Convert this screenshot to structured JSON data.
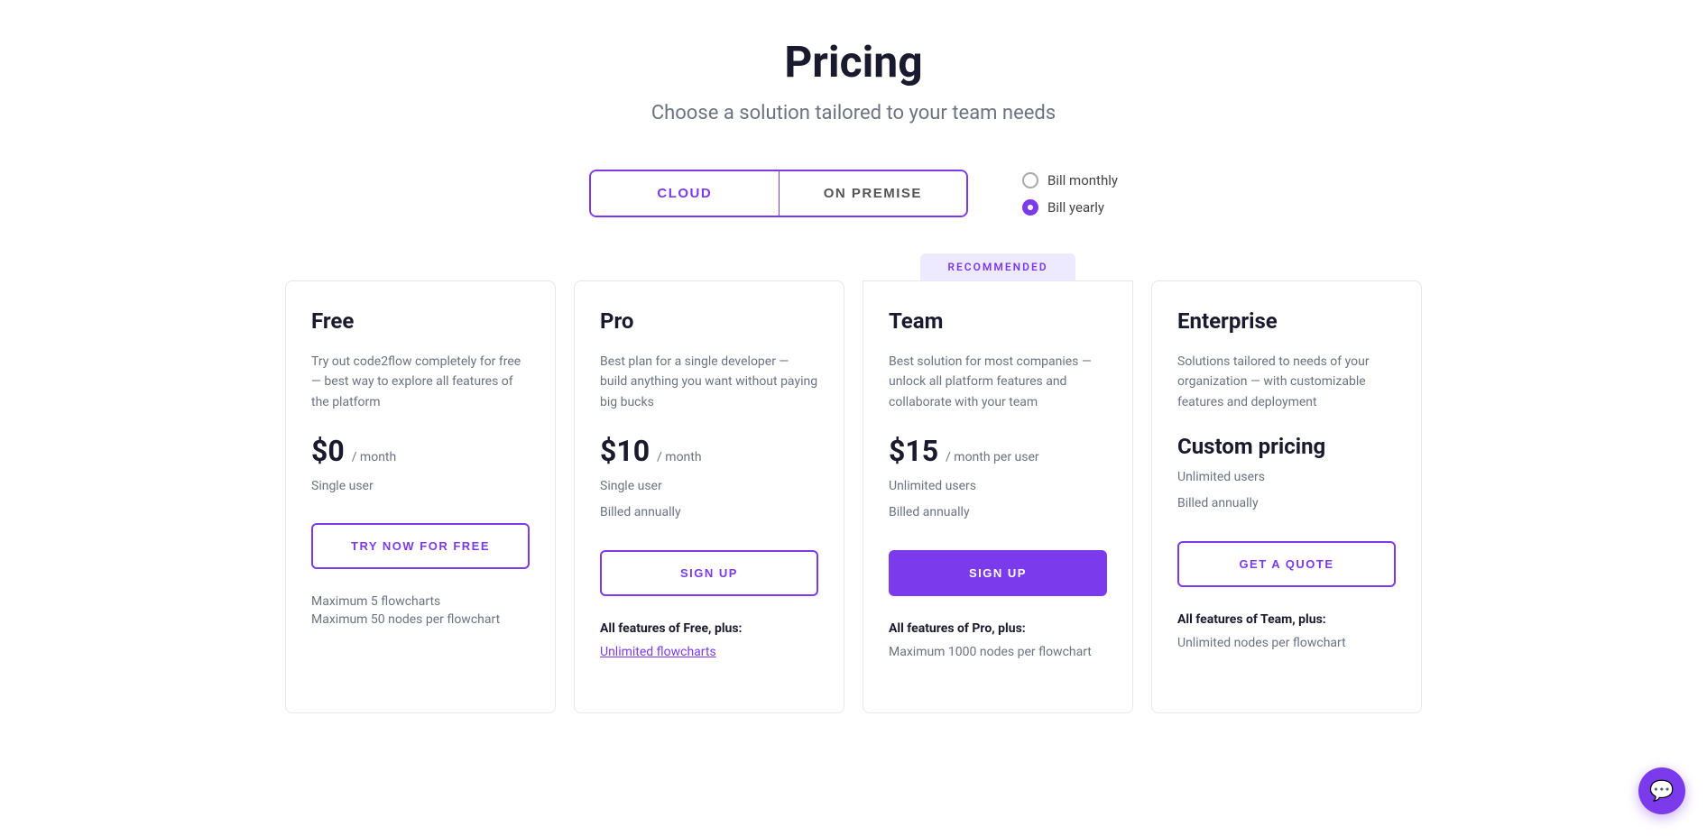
{
  "header": {
    "title": "Pricing",
    "subtitle": "Choose a solution tailored to your team needs"
  },
  "toggle": {
    "cloud_label": "CLOUD",
    "on_premise_label": "ON PREMISE",
    "active": "cloud"
  },
  "billing": {
    "monthly_label": "Bill monthly",
    "yearly_label": "Bill yearly",
    "selected": "yearly"
  },
  "recommended_label": "RECOMMENDED",
  "plans": [
    {
      "id": "free",
      "name": "Free",
      "description": "Try out code2flow completely for free — best way to explore all features of the platform",
      "price": "$0",
      "period": "/ month",
      "period_suffix": "",
      "user_lines": [
        "Single user"
      ],
      "cta_label": "TRY NOW FOR FREE",
      "cta_style": "outline",
      "features_header": "",
      "features": [
        "Maximum 5 flowcharts",
        "Maximum 50 nodes per flowchart"
      ]
    },
    {
      "id": "pro",
      "name": "Pro",
      "description": "Best plan for a single developer — build anything you want without paying big bucks",
      "price": "$10",
      "period": "/ month",
      "period_suffix": "",
      "user_lines": [
        "Single user",
        "Billed annually"
      ],
      "cta_label": "SIGN UP",
      "cta_style": "outline",
      "features_header": "All features of Free, plus:",
      "features": [
        "Unlimited flowcharts"
      ]
    },
    {
      "id": "team",
      "name": "Team",
      "description": "Best solution for most companies — unlock all platform features and collaborate with your team",
      "price": "$15",
      "period": "/ month per user",
      "period_suffix": "",
      "user_lines": [
        "Unlimited users",
        "Billed annually"
      ],
      "cta_label": "SIGN UP",
      "cta_style": "filled",
      "features_header": "All features of Pro, plus:",
      "features": [
        "Maximum 1000 nodes per flowchart"
      ]
    },
    {
      "id": "enterprise",
      "name": "Enterprise",
      "description": "Solutions tailored to needs of your organization — with customizable features and deployment",
      "price": "Custom pricing",
      "period": "",
      "period_suffix": "",
      "user_lines": [
        "Unlimited users",
        "Billed annually"
      ],
      "cta_label": "GET A QUOTE",
      "cta_style": "outline",
      "features_header": "All features of Team, plus:",
      "features": [
        "Unlimited nodes per flowchart"
      ]
    }
  ],
  "chat": {
    "icon": "💬"
  }
}
